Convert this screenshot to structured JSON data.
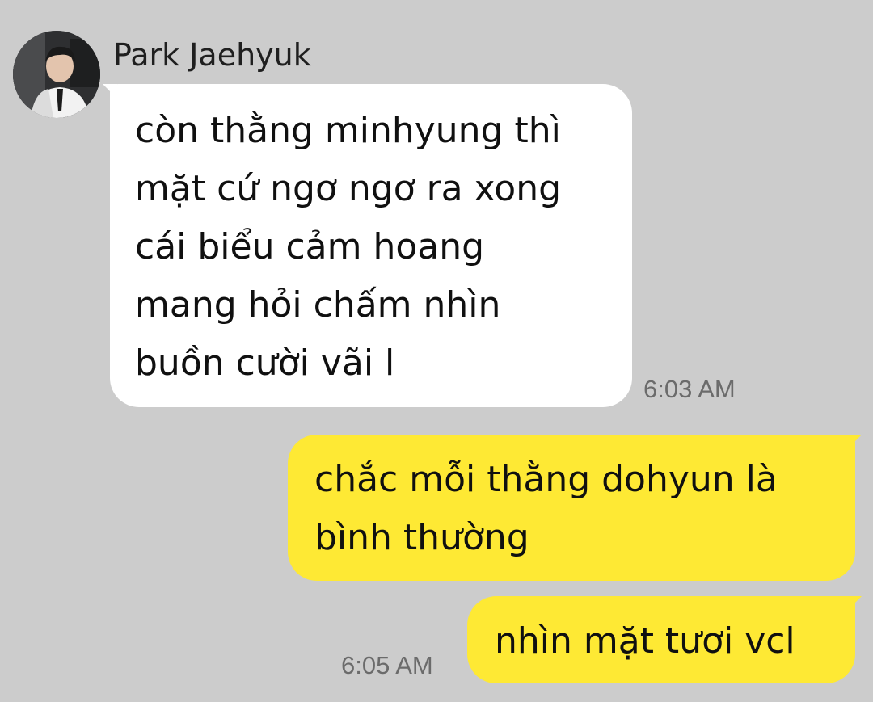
{
  "colors": {
    "background": "#cccccc",
    "incoming_bubble": "#ffffff",
    "outgoing_bubble": "#fee934",
    "timestamp": "#6b6b6b"
  },
  "conversation": {
    "sender": {
      "name": "Park Jaehyuk",
      "avatar_icon": "profile-photo"
    },
    "messages": [
      {
        "direction": "incoming",
        "text": "còn thằng minhyung thì\nmặt cứ ngơ ngơ ra xong\ncái biểu cảm hoang\nmang hỏi chấm nhìn\nbuồn cười vãi l",
        "time": "6:03 AM"
      },
      {
        "direction": "outgoing",
        "text": "chắc mỗi thằng dohyun là\nbình thường",
        "time": ""
      },
      {
        "direction": "outgoing",
        "text": "nhìn mặt tươi vcl",
        "time": "6:05 AM"
      }
    ]
  }
}
